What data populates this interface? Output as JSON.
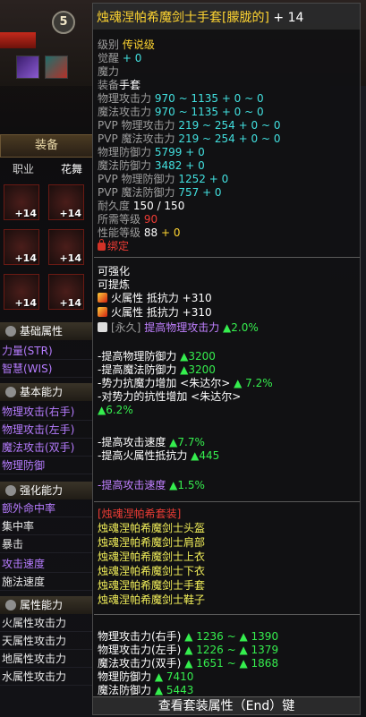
{
  "level_badge": "5",
  "equip_tab": "装备",
  "sub_tabs": [
    "职业",
    "花舞"
  ],
  "slots": [
    {
      "plus": "+14"
    },
    {
      "plus": "+14"
    },
    {
      "plus": "+14"
    },
    {
      "plus": "+14"
    },
    {
      "plus": "+14"
    },
    {
      "plus": "+14"
    }
  ],
  "sidebar": {
    "basic_attr": "基础属性",
    "str": "力量(STR)",
    "wis": "智慧(WIS)",
    "basic_ability": "基本能力",
    "phys_atk_r": "物理攻击(右手)",
    "phys_atk_l": "物理攻击(左手)",
    "mag_atk": "魔法攻击(双手)",
    "phys_def": "物理防御",
    "enhance": "强化能力",
    "extra_hit": "额外命中率",
    "focus": "集中率",
    "crit": "暴击",
    "atk_speed": "攻击速度",
    "cast_speed": "施法速度",
    "attr_ability": "属性能力",
    "fire_atk": "火属性攻击力",
    "sky_atk": "天属性攻击力",
    "earth_atk": "地属性攻击力",
    "water_atk": "水属性攻击力"
  },
  "tooltip": {
    "title": "烛魂涅帕希魔剑士手套[朦胧的]",
    "title_plus": "+ 14",
    "grade_label": "级别",
    "grade_value": "传说级",
    "awaken_label": "觉醒",
    "awaken_value": "+ 0",
    "magic_label": "魔力",
    "slot_label": "装备",
    "slot_value": "手套",
    "phys_atk": {
      "label": "物理攻击力",
      "range": "970 ~ 1135",
      "bonus": "+ 0 ~ 0"
    },
    "mag_atk": {
      "label": "魔法攻击力",
      "range": "970 ~ 1135",
      "bonus": "+ 0 ~ 0"
    },
    "pvp_phys_atk": {
      "label": "PVP 物理攻击力",
      "range": "219 ~ 254",
      "bonus": "+ 0 ~ 0"
    },
    "pvp_mag_atk": {
      "label": "PVP 魔法攻击力",
      "range": "219 ~ 254",
      "bonus": "+ 0 ~ 0"
    },
    "phys_def": {
      "label": "物理防御力",
      "value": "5799",
      "bonus": "+ 0"
    },
    "mag_def": {
      "label": "魔法防御力",
      "value": "3482",
      "bonus": "+ 0"
    },
    "pvp_phys_def": {
      "label": "PVP 物理防御力",
      "value": "1252",
      "bonus": "+ 0"
    },
    "pvp_mag_def": {
      "label": "PVP 魔法防御力",
      "value": "757",
      "bonus": "+ 0"
    },
    "durability": {
      "label": "耐久度",
      "value": "150 / 150"
    },
    "req_level": {
      "label": "所需等级",
      "value": "90"
    },
    "perf_level": {
      "label": "性能等级",
      "value": "88",
      "bonus": "+ 0"
    },
    "bound": "绑定",
    "can_enhance": "可强化",
    "can_refine": "可提炼",
    "fire_res_1": {
      "label": "火属性 抵抗力",
      "value": "+310"
    },
    "fire_res_2": {
      "label": "火属性 抵抗力",
      "value": "+310"
    },
    "perm_tag": "[永久]",
    "perm_text": "提高物理攻击力",
    "perm_value": "▲2.0%",
    "opt1": {
      "label": "-提高物理防御力",
      "value": "▲3200"
    },
    "opt2": {
      "label": "-提高魔法防御力",
      "value": "▲3200"
    },
    "opt3": {
      "label": "-势力抗魔力增加 <朱达尔>",
      "value": "▲ 7.2%"
    },
    "opt4_label": "-对势力的抗性增加 <朱达尔>",
    "opt4_value": "▲6.2%",
    "opt5": {
      "label": "-提高攻击速度",
      "value": "▲7.7%"
    },
    "opt6": {
      "label": "-提高火属性抵抗力",
      "value": "▲445"
    },
    "opt7": {
      "label": "-提高攻击速度",
      "value": "▲1.5%"
    },
    "set_name": "[烛魂涅帕希套装]",
    "set_items": [
      "烛魂涅帕希魔剑士头盔",
      "烛魂涅帕希魔剑士肩部",
      "烛魂涅帕希魔剑士上衣",
      "烛魂涅帕希魔剑士下衣",
      "烛魂涅帕希魔剑士手套",
      "烛魂涅帕希魔剑士鞋子"
    ],
    "cmp1": {
      "label": "物理攻击力(右手)",
      "a": "▲ 1236",
      "b": "~ ▲ 1390"
    },
    "cmp2": {
      "label": "物理攻击力(左手)",
      "a": "▲ 1226",
      "b": "~ ▲ 1379"
    },
    "cmp3": {
      "label": "魔法攻击力(双手)",
      "a": "▲ 1651",
      "b": "~ ▲ 1868"
    },
    "cmp4": {
      "label": "物理防御力",
      "a": "▲ 7410"
    },
    "cmp5": {
      "label": "魔法防御力",
      "a": "▲ 5443"
    },
    "footer": "查看套装属性（End）键"
  }
}
